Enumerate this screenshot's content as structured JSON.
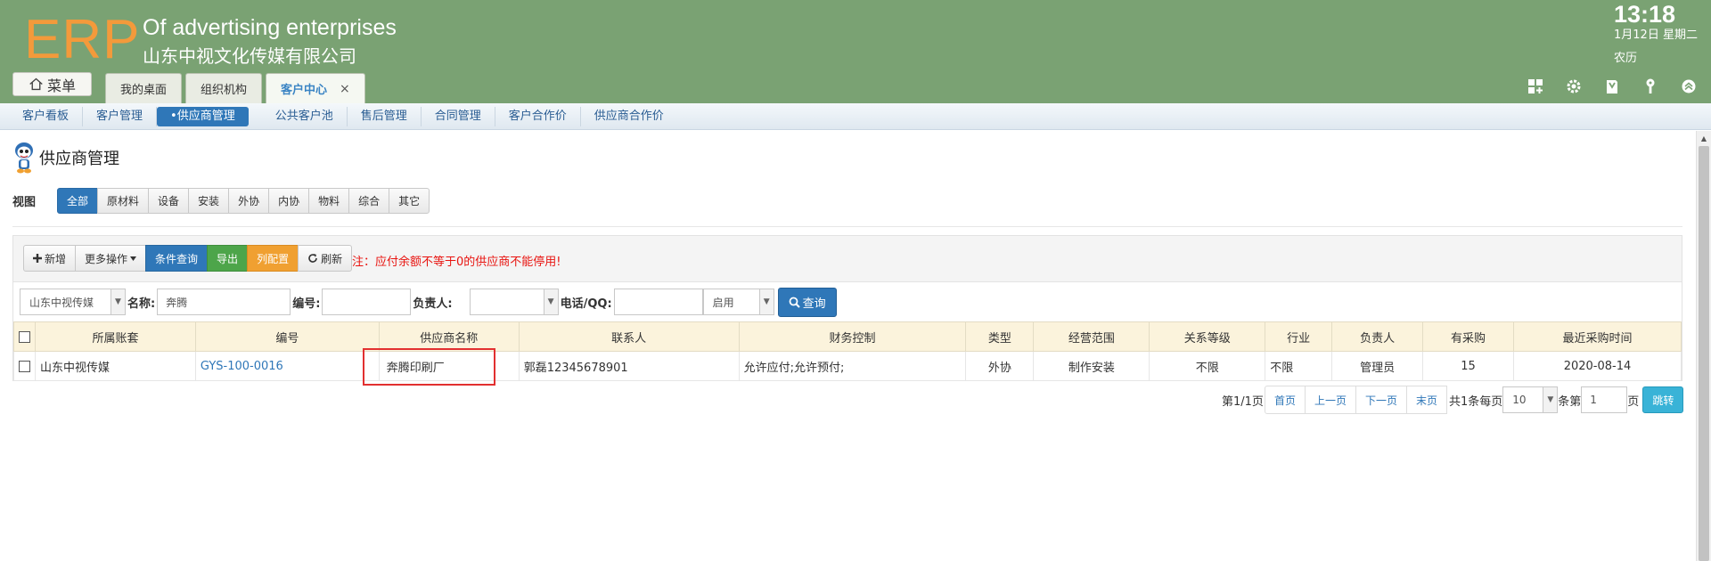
{
  "header": {
    "logo": "ERP",
    "company_en": "Of advertising enterprises",
    "company_cn": "山东中视文化传媒有限公司",
    "time": "13:18",
    "date": "1月12日 星期二",
    "lunar": "农历",
    "menu_label": "菜单",
    "tabs": [
      {
        "label": "我的桌面"
      },
      {
        "label": "组织机构"
      },
      {
        "label": "客户中心",
        "close": "×"
      }
    ],
    "icons": [
      "grid-add-icon",
      "gear-icon",
      "book-icon",
      "key-icon",
      "collapse-up-icon"
    ]
  },
  "subnav": [
    "客户看板",
    "客户管理",
    "•供应商管理",
    "公共客户池",
    "售后管理",
    "合同管理",
    "客户合作价",
    "供应商合作价"
  ],
  "page": {
    "title": "供应商管理",
    "view_label": "视图",
    "views": [
      "全部",
      "原材料",
      "设备",
      "安装",
      "外协",
      "内协",
      "物料",
      "综合",
      "其它"
    ]
  },
  "toolbar": {
    "add": "新增",
    "more": "更多操作",
    "condition": "条件查询",
    "export": "导出",
    "columns": "列配置",
    "refresh": "刷新",
    "note": "注：应付余额不等于0的供应商不能停用!"
  },
  "filters": {
    "account": "山东中视传媒",
    "name_label": "名称:",
    "name_value": "奔腾",
    "code_label": "编号:",
    "code_value": "",
    "owner_label": "负责人:",
    "owner_value": "",
    "phone_label": "电话/QQ:",
    "phone_value": "",
    "status": "启用",
    "search": "查询"
  },
  "table": {
    "headers": [
      "所属账套",
      "编号",
      "供应商名称",
      "联系人",
      "财务控制",
      "类型",
      "经营范围",
      "关系等级",
      "行业",
      "负责人",
      "有采购",
      "最近采购时间"
    ],
    "rows": [
      [
        "山东中视传媒",
        "GYS-100-0016",
        "奔腾印刷厂",
        "郭磊12345678901",
        "允许应付;允许预付;",
        "外协",
        "制作安装",
        "不限",
        "不限",
        "管理员",
        "15",
        "2020-08-14"
      ]
    ]
  },
  "pager": {
    "page_info": "第1/1页",
    "first": "首页",
    "prev": "上一页",
    "next": "下一页",
    "last": "末页",
    "total_prefix": "共1条每页",
    "page_size": "10",
    "size_suffix": "条第",
    "page_input": "1",
    "page_suffix": "页",
    "jump": "跳转"
  }
}
